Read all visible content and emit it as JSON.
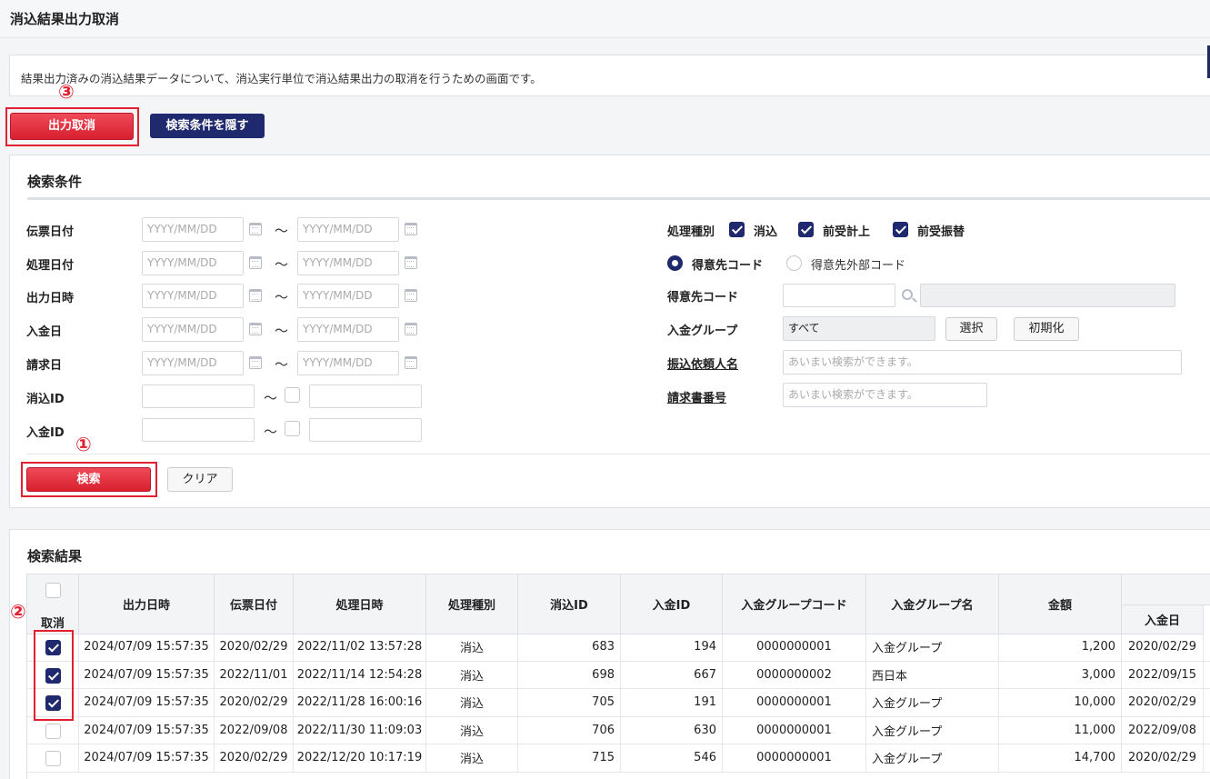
{
  "page": {
    "title": "消込結果出力取消",
    "description": "結果出力済みの消込結果データについて、消込実行単位で消込結果出力の取消を行うための画面です。"
  },
  "toolbar": {
    "cancel_output_label": "出力取消",
    "hide_conditions_label": "検索条件を隠す"
  },
  "markers": {
    "one": "①",
    "two": "②",
    "three": "③"
  },
  "conditions": {
    "title": "検索条件",
    "date_placeholder": "YYYY/MM/DD",
    "tilde": "〜",
    "date_rows": [
      {
        "label": "伝票日付"
      },
      {
        "label": "処理日付"
      },
      {
        "label": "出力日時"
      },
      {
        "label": "入金日"
      },
      {
        "label": "請求日"
      }
    ],
    "id_rows": [
      {
        "label": "消込ID"
      },
      {
        "label": "入金ID"
      }
    ],
    "process_type": {
      "label": "処理種別",
      "options": [
        {
          "label": "消込",
          "checked": true
        },
        {
          "label": "前受計上",
          "checked": true
        },
        {
          "label": "前受振替",
          "checked": true
        }
      ]
    },
    "code_type": {
      "options": [
        {
          "label": "得意先コード",
          "selected": true
        },
        {
          "label": "得意先外部コード",
          "selected": false
        }
      ]
    },
    "customer_code": {
      "label": "得意先コード",
      "value": "",
      "name_value": ""
    },
    "deposit_group": {
      "label": "入金グループ",
      "value": "すべて",
      "select_label": "選択",
      "reset_label": "初期化"
    },
    "transfer_requester": {
      "label": "振込依頼人名",
      "placeholder": "あいまい検索ができます。"
    },
    "invoice_number": {
      "label": "請求書番号",
      "placeholder": "あいまい検索ができます。"
    },
    "search_label": "検索",
    "clear_label": "クリア"
  },
  "results": {
    "title": "検索結果",
    "columns": {
      "cancel": "取消",
      "output_datetime": "出力日時",
      "slip_date": "伝票日付",
      "process_datetime": "処理日時",
      "process_type": "処理種別",
      "reconcile_id": "消込ID",
      "deposit_id": "入金ID",
      "group_code": "入金グループコード",
      "group_name": "入金グループ名",
      "amount": "金額",
      "deposit_date": "入金日"
    },
    "rows": [
      {
        "checked": true,
        "output_datetime": "2024/07/09 15:57:35",
        "slip_date": "2020/02/29",
        "process_datetime": "2022/11/02 13:57:28",
        "process_type": "消込",
        "reconcile_id": "683",
        "deposit_id": "194",
        "group_code": "0000000001",
        "group_name": "入金グループ",
        "amount": "1,200",
        "deposit_date": "2020/02/29"
      },
      {
        "checked": true,
        "output_datetime": "2024/07/09 15:57:35",
        "slip_date": "2022/11/01",
        "process_datetime": "2022/11/14 12:54:28",
        "process_type": "消込",
        "reconcile_id": "698",
        "deposit_id": "667",
        "group_code": "0000000002",
        "group_name": "西日本",
        "amount": "3,000",
        "deposit_date": "2022/09/15"
      },
      {
        "checked": true,
        "output_datetime": "2024/07/09 15:57:35",
        "slip_date": "2020/02/29",
        "process_datetime": "2022/11/28 16:00:16",
        "process_type": "消込",
        "reconcile_id": "705",
        "deposit_id": "191",
        "group_code": "0000000001",
        "group_name": "入金グループ",
        "amount": "10,000",
        "deposit_date": "2020/02/29"
      },
      {
        "checked": false,
        "output_datetime": "2024/07/09 15:57:35",
        "slip_date": "2022/09/08",
        "process_datetime": "2022/11/30 11:09:03",
        "process_type": "消込",
        "reconcile_id": "706",
        "deposit_id": "630",
        "group_code": "0000000001",
        "group_name": "入金グループ",
        "amount": "11,000",
        "deposit_date": "2022/09/08"
      },
      {
        "checked": false,
        "output_datetime": "2024/07/09 15:57:35",
        "slip_date": "2020/02/29",
        "process_datetime": "2022/12/20 10:17:19",
        "process_type": "消込",
        "reconcile_id": "715",
        "deposit_id": "546",
        "group_code": "0000000001",
        "group_name": "入金グループ",
        "amount": "14,700",
        "deposit_date": "2020/02/29"
      }
    ]
  }
}
